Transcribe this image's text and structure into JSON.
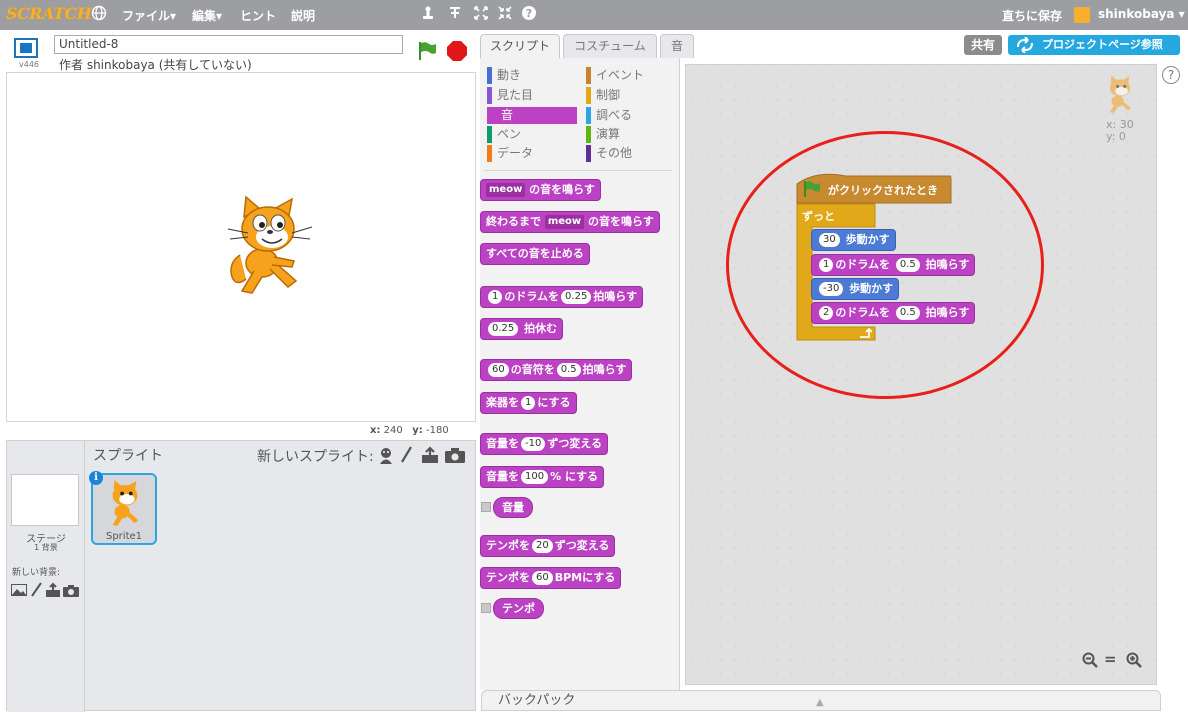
{
  "menubar": {
    "logo": "SCRATCH",
    "file": "ファイル▾",
    "edit": "編集▾",
    "tips": "ヒント",
    "about": "説明",
    "save_now": "直ちに保存",
    "username": "shinkobaya ▾"
  },
  "stage_header": {
    "version": "v446",
    "project_title": "Untitled-8",
    "author_line": "作者 shinkobaya (共有していない)"
  },
  "stage": {
    "coords_x_label": "x:",
    "coords_x": "240",
    "coords_y_label": "y:",
    "coords_y": "-180"
  },
  "sprites_pane": {
    "title": "スプライト",
    "new_sprite_label": "新しいスプライト:",
    "stage_label": "ステージ",
    "backdrops_count": "1 背景",
    "new_backdrop_label": "新しい背景:",
    "sprite_name": "Sprite1"
  },
  "tabs": {
    "scripts": "スクリプト",
    "costumes": "コスチューム",
    "sounds": "音"
  },
  "top_right": {
    "share": "共有",
    "see_project_page": "プロジェクトページ参照"
  },
  "categories": [
    {
      "label": "動き",
      "color": "#4a6cd4"
    },
    {
      "label": "見た目",
      "color": "#8a55d7"
    },
    {
      "label": "音",
      "color": "#bb42c3"
    },
    {
      "label": "ペン",
      "color": "#0e9a6c"
    },
    {
      "label": "データ",
      "color": "#ee7d16"
    },
    {
      "label": "イベント",
      "color": "#c88330"
    },
    {
      "label": "制御",
      "color": "#e1a91a"
    },
    {
      "label": "調べる",
      "color": "#2ca5e2"
    },
    {
      "label": "演算",
      "color": "#5cb712"
    },
    {
      "label": "その他",
      "color": "#632d99"
    }
  ],
  "palette_blocks": {
    "play_sound": {
      "value": "meow",
      "text": "の音を鳴らす"
    },
    "play_sound_until_done": {
      "prefix": "終わるまで",
      "value": "meow",
      "text": "の音を鳴らす"
    },
    "stop_all_sounds": "すべての音を止める",
    "play_drum": {
      "drum": "1",
      "mid": "のドラムを",
      "beats": "0.25",
      "suffix": "拍鳴らす"
    },
    "rest": {
      "beats": "0.25",
      "suffix": "拍休む"
    },
    "play_note": {
      "note": "60",
      "mid": "の音符を",
      "beats": "0.5",
      "suffix": "拍鳴らす"
    },
    "set_instrument": {
      "prefix": "楽器を",
      "value": "1",
      "suffix": "にする"
    },
    "change_volume": {
      "prefix": "音量を",
      "value": "-10",
      "suffix": "ずつ変える"
    },
    "set_volume": {
      "prefix": "音量を",
      "value": "100",
      "suffix": "% にする"
    },
    "volume_reporter": "音量",
    "change_tempo": {
      "prefix": "テンポを",
      "value": "20",
      "suffix": "ずつ変える"
    },
    "set_tempo": {
      "prefix": "テンポを",
      "value": "60",
      "suffix": "BPMにする"
    },
    "tempo_reporter": "テンポ"
  },
  "script": {
    "hat": "がクリックされたとき",
    "forever": "ずっと",
    "move1": {
      "value": "30",
      "text": "歩動かす"
    },
    "drum1": {
      "drum": "1",
      "mid": "のドラムを",
      "beats": "0.5",
      "suffix": "拍鳴らす"
    },
    "move2": {
      "value": "-30",
      "text": "歩動かす"
    },
    "drum2": {
      "drum": "2",
      "mid": "のドラムを",
      "beats": "0.5",
      "suffix": "拍鳴らす"
    }
  },
  "sprite_info": {
    "x_label": "x:",
    "x": "30",
    "y_label": "y:",
    "y": "0"
  },
  "backpack": {
    "label": "バックパック"
  },
  "zoom": {
    "out": "−",
    "reset": "=",
    "in": "+"
  },
  "colors": {
    "menubar": "#9c9ea2",
    "sound_block": "#bb42c3",
    "motion_block": "#4c7ad4",
    "control_block": "#e1a91a",
    "event_block": "#c88a30",
    "highlight_circle": "#e8201a",
    "share_button": "#8c8c8c",
    "project_page_button": "#25a8e0"
  }
}
